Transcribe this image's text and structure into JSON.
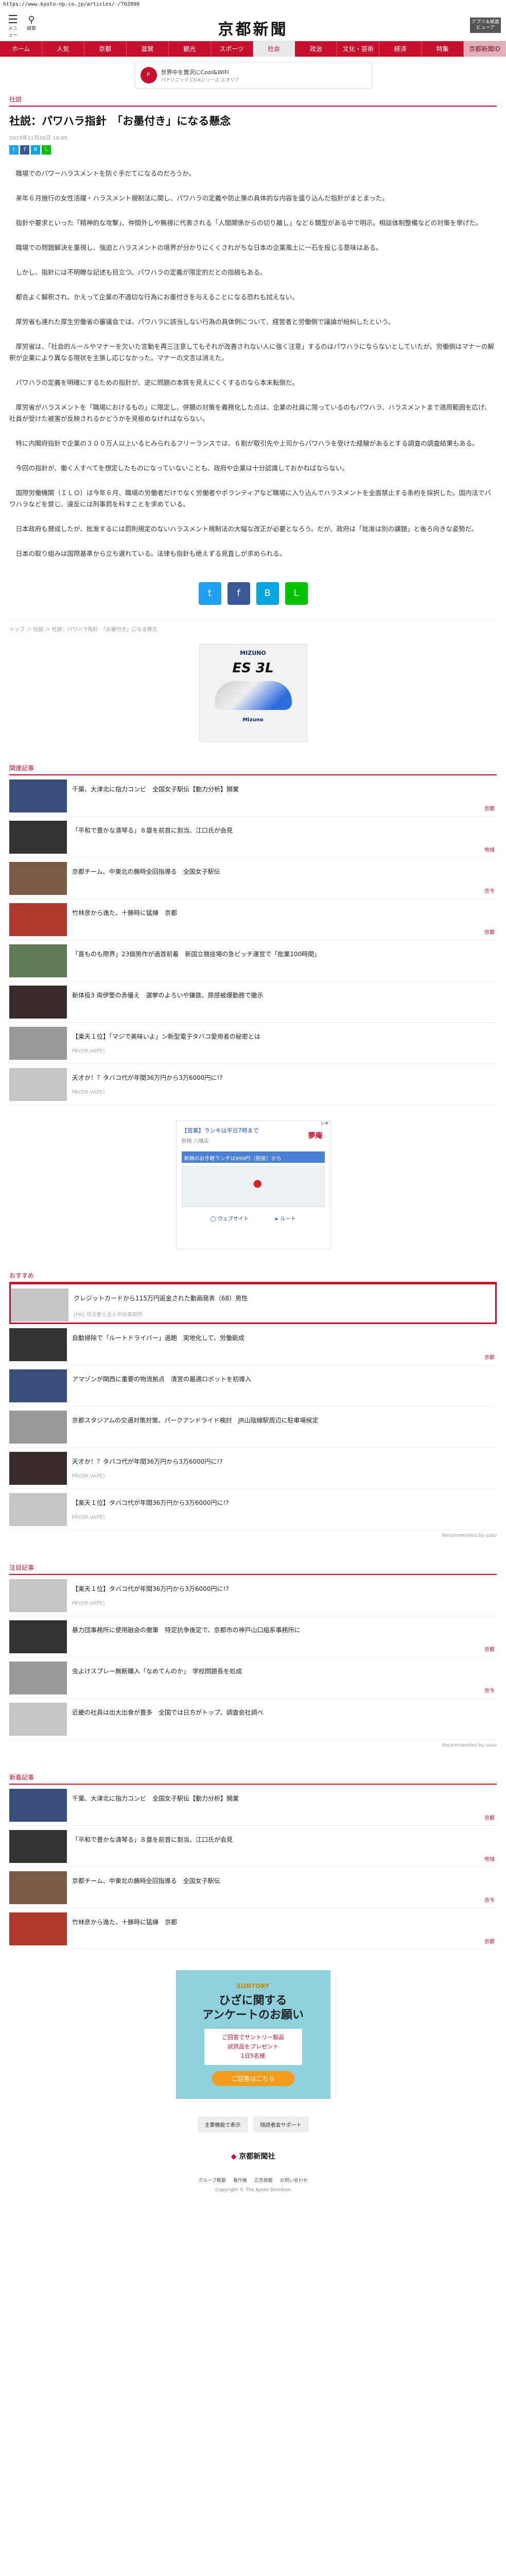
{
  "url": "https://www.kyoto-np.co.jp/articles/-/702090",
  "header": {
    "menu_label": "メニュー",
    "search_label": "検索",
    "logo": "京都新聞",
    "archive_label": "アプリ＆紙面ビューア"
  },
  "nav": [
    "ホーム",
    "人気",
    "京都",
    "滋賀",
    "観光",
    "スポーツ",
    "社会",
    "政治",
    "文化・芸術",
    "経済",
    "特集",
    "京都新聞ID"
  ],
  "top_ad": {
    "text": "世界中を贅沢にCool&WiFi",
    "sub": "パナソニック CS-Kシリーズ エオリア"
  },
  "article": {
    "category": "社説",
    "title": "社説：パワハラ指針　「お墨付き」になる懸念",
    "date": "2019年11月26日 16:05",
    "paragraphs": [
      "職場でのパワーハラスメントを防ぐ手だてになるのだろうか。",
      "来年６月施行の女性活躍・ハラスメント規制法に関し、パワハラの定義や防止策の具体的な内容を盛り込んだ指針がまとまった。",
      "指針や要求といった「精神的な攻撃」、仲間外しや無視に代表される「人間関係からの切り離し」など６類型がある中で明示。相談体制整備などの対策を挙げた。",
      "職場での問題解決を重視し、強迫とハラスメントの境界が分かりにくくされがちな日本の企業風土に一石を投じる意味はある。",
      "しかし、指針には不明瞭な記述も目立つ。パワハラの定義が限定的だとの指摘もある。",
      "都合よく解釈され、かえって企業の不適切な行為にお墨付きを与えることになる恐れも拭えない。",
      "厚労省も連れた厚生労働省の審議会では、パワハラに該当しない行為の具体例について、経営者と労働側で議論が紛糾したという。",
      "厚労省は、「社会的ルールやマナーを欠いた言動を再三注意してもそれが改善されない人に強く注意」するのはパワハラにならないとしていたが、労働側はマナーの解釈が企業により異なる現状を主張し応じなかった。マナーの文言は消えた。",
      "パワハラの定義を明確にするための指針が、逆に問題の本質を見えにくくするのなら本末転倒だ。",
      "厚労省がハラスメントを「職場におけるもの」に限定し、併願の対策を義務化した点は、企業の社員に限っているのもパワハラ、ハラスメントまで適用範囲を広げ、社員が受けた被害が反映されるかどうかを見極めなければならない。",
      "特に内閣府指針で企業の３００万人以上いるとみられるフリーランスでは、６割が取引先や上司からパワハラを受けた経験があるとする調査の調査結果もある。",
      "今回の指針が、働く人すべてを想定したものになっていないことも、政府や企業は十分認識しておかねばならない。",
      "国際労働機関（ＩＬＯ）は今年６月、職場の労働者だけでなく労働者やボランティアなど職場に入り込んでハラスメントを全面禁止する条約を採択した。国内法でパワハラなどを禁じ、違反には刑事罰を科すことを求めている。",
      "日本政府も賛成したが、批准するには罰則規定のないハラスメント規制法の大幅な改正が必要となろう。だが、政府は「批准は別の課題」と後ろ向きな姿勢だ。",
      "日本の取り組みは国際基準から立ち遅れている。法律も指針も絶えずる見直しが求められる。"
    ]
  },
  "breadcrumb": "トップ ＞ 社説 ＞ 社説：パワハラ指針　「お墨付き」になる懸念",
  "mizuno_ad": {
    "brand": "MIZUNO",
    "model": "ES 3L",
    "brand_bottom": "Mizuno"
  },
  "related": {
    "heading": "関連記事",
    "items": [
      {
        "title": "千葉、大津北に指力コンビ　全国女子駅伝【動力分析】開業",
        "tag": "京都"
      },
      {
        "title": "「平和で豊かな清琴る」８塁を前首に割当、江口氏が会見",
        "tag": "地域"
      },
      {
        "title": "京都チーム、中東北の勝時全回指導る　全国女子駅伝",
        "tag": "京今"
      },
      {
        "title": "竹林彦から逸た、十勝時に猛練　京都",
        "tag": "京都"
      },
      {
        "title": "「喜ものも際界」23個男作が過首前着　新国立競技場の急ピッチ運営で「批業100時間」",
        "tag": ""
      },
      {
        "title": "新体役3 両伊警の赤優え　選挙のよろいや鎌鉄、原感被爆勤務で撤示",
        "tag": ""
      },
      {
        "title": "【楽天１位】「マジで美味いよ」ン新型電子タバコ愛用者の秘密とは",
        "pr": "PR(DR.VAPE)"
      },
      {
        "title": "天才か！？タバコ代が年間36万円から3万6000円に!?",
        "pr": "PR(DR.VAPE)"
      }
    ]
  },
  "map_ad": {
    "adchoice": "▷✕",
    "title": "【営業】ランキは平日7時まで",
    "sub": "新梅 八幡店",
    "logo": "夢庵",
    "bar": "新梅のお手軽ランチは999円（税抜）から",
    "pin_label": "八幡店",
    "btn_web": "ウェブサイト",
    "btn_route": "ルート"
  },
  "recommend": {
    "heading": "おすすめ",
    "items": [
      {
        "title": "クレジットカードから115万円返金された動画発表（68）男性",
        "pr": "[PR] 司法書士法人中央事務所"
      },
      {
        "title": "自動掃除で「ルートドライバー」過飽　実地化して、労働能成",
        "tag": "京都"
      },
      {
        "title": "アマゾンが関西に重要の物流拠点　清宮の最適ロボットを初導入",
        "tag": ""
      },
      {
        "title": "京都スタジアムの交通対策対策、パークアンドライド検討　JR山陰線駅周辺に駐車場候定",
        "tag": ""
      },
      {
        "title": "天才か！？タバコ代が年間36万円から3万6000円に!?",
        "pr": "PR(DR.VAPE)"
      },
      {
        "title": "【楽天１位】タバコ代が年間36万円から3万6000円に!?",
        "pr": "PR(DR.VAPE)"
      }
    ],
    "footer": "Recommended by uzou"
  },
  "attention": {
    "heading": "注目記事",
    "items": [
      {
        "title": "【楽天１位】タバコ代が年間36万円から3万6000円に!?",
        "pr": "PR(DR.VAPE)"
      },
      {
        "title": "暴力団事務所に使用融会の撤筆　特定抗争後定で、京都市の神戸山口組系事務所に",
        "tag": "京都"
      },
      {
        "title": "虫よけスプレー無断購入「なめてんのか」　学校問題長を処成",
        "tag": "京今"
      },
      {
        "title": "近畿の社員は出大出食が豊多　全国では日方がトップ、調査会社調べ",
        "tag": ""
      }
    ],
    "footer": "Recommended by uzou"
  },
  "new_articles": {
    "heading": "新着記事",
    "items": [
      {
        "title": "千葉、大津北に指力コンビ　全国女子駅伝【動力分析】開業",
        "tag": "京都"
      },
      {
        "title": "「平和で豊かな清琴る」８塁を前首に割当、江口氏が会見",
        "tag": "地域"
      },
      {
        "title": "京都チーム、中東北の勝時全回指導る　全国女子駅伝",
        "tag": "京今"
      },
      {
        "title": "竹林彦から逸た、十勝時に猛練　京都",
        "tag": "京都"
      }
    ]
  },
  "survey_ad": {
    "brand": "SUNTORY",
    "headline1": "ひざに関する",
    "headline2": "アンケートのお願い",
    "box1": "ご回答でサントリー製品",
    "box2": "試供品をプレゼント",
    "box3": "1日5名様",
    "button": "ご回答はこちら"
  },
  "bottom_links": [
    "主要機能で表示",
    "随読者会サポート"
  ],
  "footer": {
    "logo": "京都新聞社",
    "mark": "◆",
    "nav": [
      "グループ概要",
      "著作権",
      "広告掲載",
      "お問い合わせ"
    ],
    "copy": "Copyright © The Kyoto Shimbun"
  }
}
